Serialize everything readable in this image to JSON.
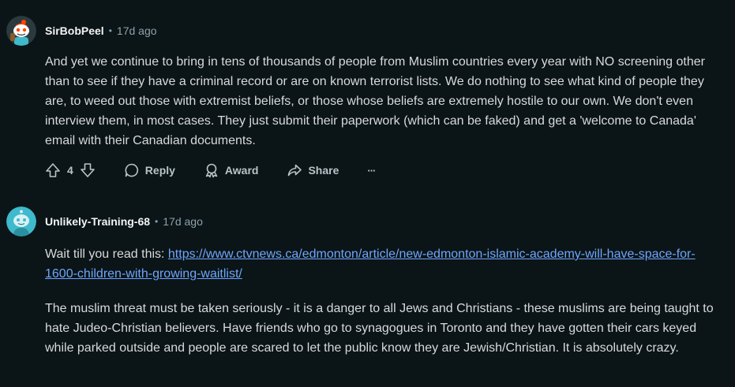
{
  "comments": [
    {
      "author": "SirBobPeel",
      "time": "17d ago",
      "body": "And yet we continue to bring in tens of thousands of people from Muslim countries every year with NO screening other than to see if they have a criminal record or are on known terrorist lists. We do nothing to see what kind of people they are, to weed out those with extremist beliefs, or those whose beliefs are extremely hostile to our own. We don't even interview them, in most cases. They just submit their paperwork (which can be faked) and get a 'welcome to Canada' email with their Canadian documents.",
      "actions": {
        "upvote_icon": "arrow-up-icon",
        "vote_count": "4",
        "downvote_icon": "arrow-down-icon",
        "reply_label": "Reply",
        "award_label": "Award",
        "share_label": "Share",
        "more_label": "···"
      },
      "avatar_color": "#ffffff"
    },
    {
      "author": "Unlikely-Training-68",
      "time": "17d ago",
      "body_prefix": "Wait till you read this: ",
      "link": "https://www.ctvnews.ca/edmonton/article/new-edmonton-islamic-academy-will-have-space-for-1600-children-with-growing-waitlist/",
      "body_para2": "The muslim threat must be taken seriously - it is a danger to all Jews and Christians - these muslims are being taught to hate Judeo-Christian believers. Have friends who go to synagogues in Toronto and they have gotten their cars keyed while parked outside and people are scared to let the public know they are Jewish/Christian. It is absolutely crazy.",
      "avatar_color": "#3fb9cc"
    }
  ],
  "separator": "•",
  "colors": {
    "background": "#0b1416",
    "text": "#d7dadc",
    "muted": "#8ba2ad",
    "link": "#6ea6ff"
  }
}
